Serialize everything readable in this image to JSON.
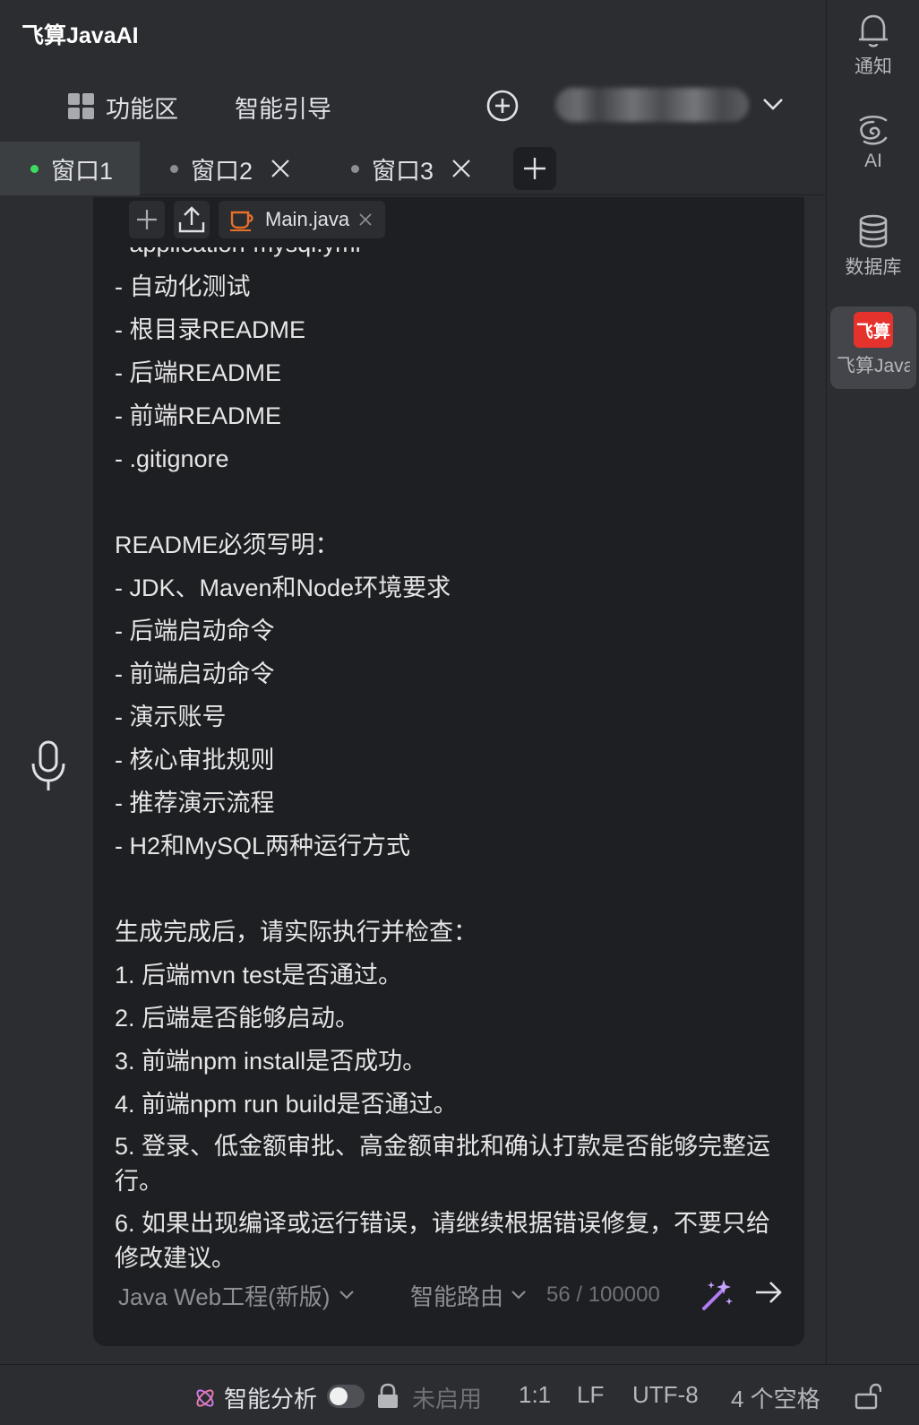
{
  "app": {
    "title": "飞算JavaAI"
  },
  "toolbar": {
    "features_label": "功能区",
    "guide_label": "智能引导"
  },
  "tabs": [
    {
      "label": "窗口1",
      "active": true
    },
    {
      "label": "窗口2",
      "active": false
    },
    {
      "label": "窗口3",
      "active": false
    }
  ],
  "attachment": {
    "file_name": "Main.java"
  },
  "message": {
    "lines": [
      "- application-mysql.yml",
      "- 自动化测试",
      "- 根目录README",
      "- 后端README",
      "- 前端README",
      "- .gitignore",
      "",
      "README必须写明：",
      "- JDK、Maven和Node环境要求",
      "- 后端启动命令",
      "- 前端启动命令",
      "- 演示账号",
      "- 核心审批规则",
      "- 推荐演示流程",
      "- H2和MySQL两种运行方式",
      "",
      "生成完成后，请实际执行并检查：",
      "1. 后端mvn test是否通过。",
      "2. 后端是否能够启动。",
      "3. 前端npm install是否成功。",
      "4. 前端npm run build是否通过。",
      "5. 登录、低金额审批、高金额审批和确认打款是否能够完整运行。",
      "6. 如果出现编译或运行错误，请继续根据错误修复，不要只给修改建议。"
    ]
  },
  "input_footer": {
    "model_label": "Java Web工程(新版)",
    "route_label": "智能路由",
    "char_count": "56 / 100000"
  },
  "sidebar": {
    "notify_label": "通知",
    "ai_label": "AI",
    "db_label": "数据库",
    "feisuan_logo_text": "飞算",
    "feisuan_label": "飞算JavaAI"
  },
  "statusbar": {
    "analysis_label": "智能分析",
    "analysis_enabled": false,
    "disabled_label": "未启用",
    "cursor_pos": "1:1",
    "line_sep": "LF",
    "encoding": "UTF-8",
    "indent": "4 个空格"
  },
  "colors": {
    "background": "#2b2d30",
    "card": "#1e1f22",
    "active_dot": "#3ddc61",
    "java_icon": "#e8702a",
    "feisuan_red": "#e5322d"
  }
}
